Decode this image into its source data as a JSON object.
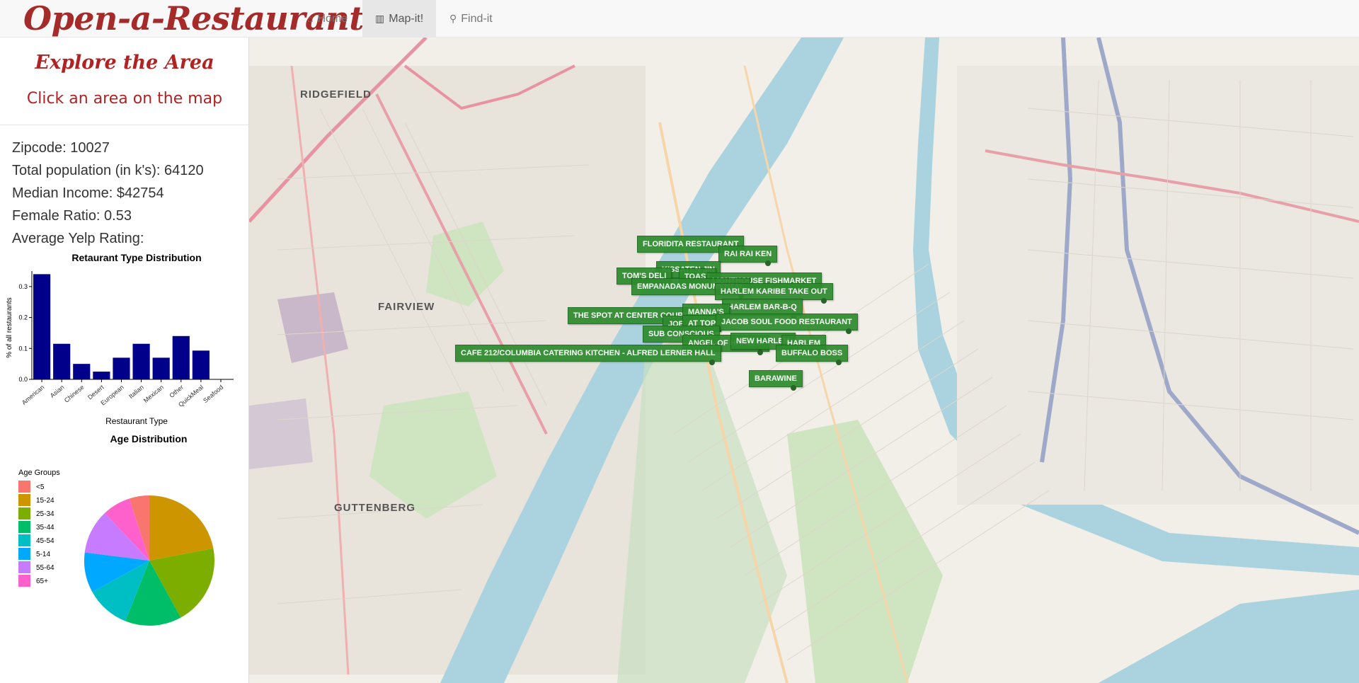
{
  "nav": {
    "brand": "Open-a-Restaurant",
    "items": [
      {
        "label": "Home",
        "icon": "home-icon",
        "active": false
      },
      {
        "label": "Map-it!",
        "icon": "map-icon",
        "active": true
      },
      {
        "label": "Find-it",
        "icon": "search-icon",
        "active": false
      }
    ]
  },
  "sidebar": {
    "title": "Explore the Area",
    "subtitle": "Click an area on the map",
    "zipcode": "Zipcode: 10027",
    "population": "Total population (in k's): 64120",
    "income": "Median Income: $42754",
    "female_ratio": "Female Ratio: 0.53",
    "yelp": "Average Yelp Rating:"
  },
  "chart_data": [
    {
      "type": "bar",
      "title": "Retaurant Type Distribution",
      "xlabel": "Restaurant Type",
      "ylabel": "% of all restaurants",
      "categories": [
        "American",
        "Asian",
        "Chinese",
        "Desert",
        "European",
        "Italian",
        "Mexican",
        "Other",
        "QuickMeal",
        "Seafood"
      ],
      "values": [
        0.34,
        0.115,
        0.05,
        0.025,
        0.07,
        0.115,
        0.07,
        0.14,
        0.093,
        0.0
      ],
      "yticks": [
        "0.0",
        "0.1",
        "0.2",
        "0.3"
      ],
      "ylim": [
        0,
        0.35
      ],
      "color": "#00008b"
    },
    {
      "type": "pie",
      "title": "Age Distribution",
      "legend_title": "Age Groups",
      "labels": [
        "<5",
        "15-24",
        "25-34",
        "35-44",
        "45-54",
        "5-14",
        "55-64",
        "65+"
      ],
      "values": [
        0.05,
        0.22,
        0.2,
        0.14,
        0.11,
        0.1,
        0.11,
        0.07
      ],
      "colors": [
        "#f8766d",
        "#cd9600",
        "#7cae00",
        "#00be67",
        "#00bfc4",
        "#00a9ff",
        "#c77cff",
        "#ff61cc"
      ]
    }
  ],
  "map": {
    "places": [
      "RIDGEFIELD",
      "FAIRVIEW",
      "GUTTENBERG"
    ],
    "markers": [
      "FLORIDITA RESTAURANT",
      "RAI RAI KEN",
      "KISSATEN JIN",
      "TOM'S DELI",
      "TOAST",
      "LIGHTHOUSE FISHMARKET",
      "EMPANADAS MONUMENTAL",
      "HARLEM KARIBE TAKE OUT",
      "HARLEM BAR-B-Q",
      "THE SPOT AT CENTER COURT",
      "MANNA'S",
      "JOE",
      "AT TOP",
      "JACOB SOUL FOOD RESTAURANT",
      "SUB CONSCIOUS",
      "ANGEL OF HARLEM",
      "NEW HARLEM",
      "HARLEM",
      "CAFE 212/COLUMBIA CATERING KITCHEN - ALFRED LERNER HALL",
      "BUFFALO BOSS",
      "BARAWINE"
    ]
  }
}
